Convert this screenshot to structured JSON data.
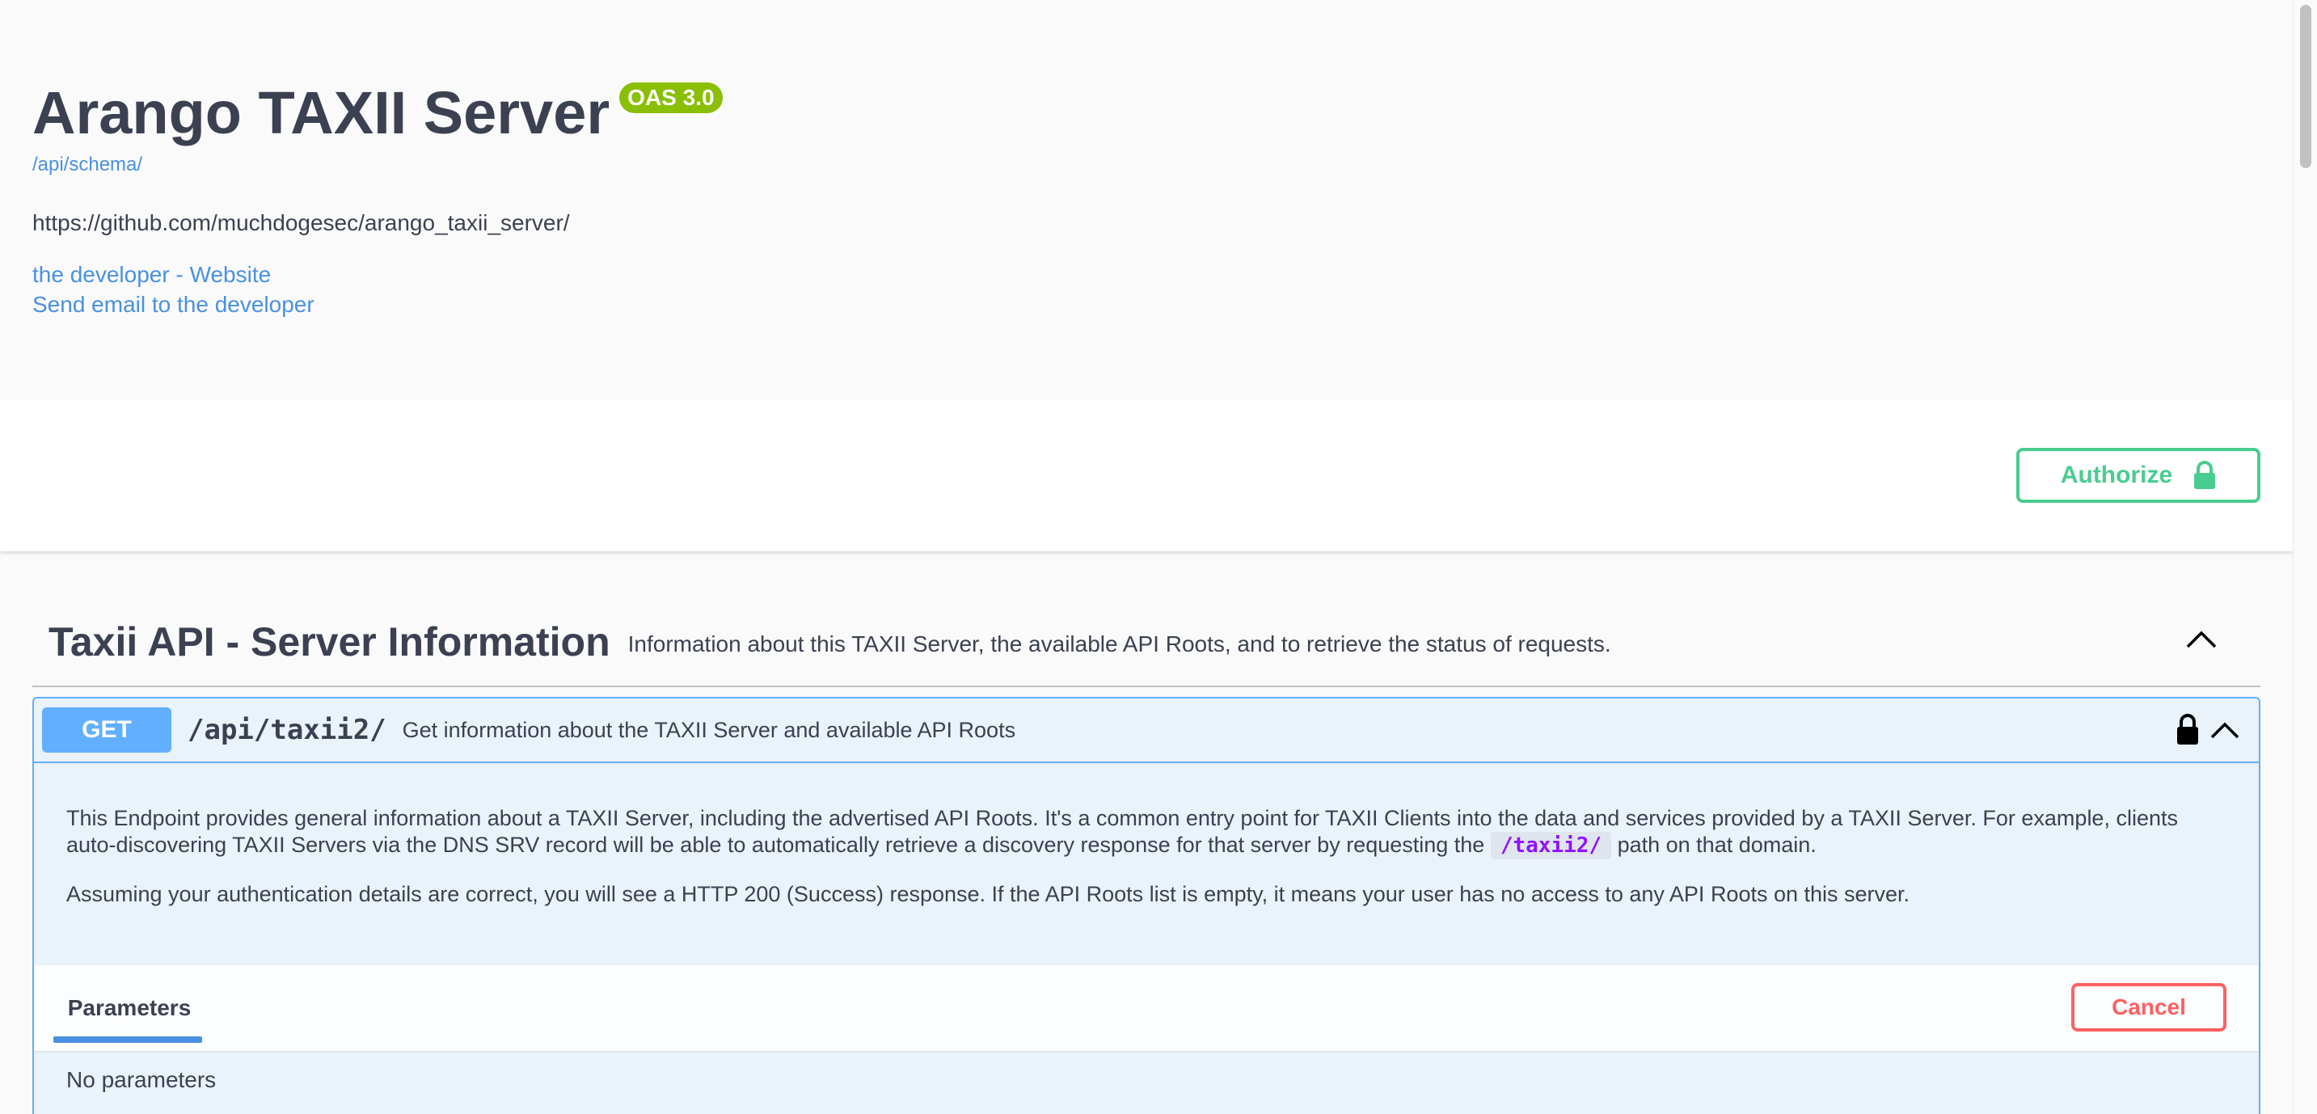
{
  "info": {
    "title": "Arango TAXII Server",
    "version_badge": "OAS 3.0",
    "schema_link": "/api/schema/",
    "description_url": "https://github.com/muchdogesec/arango_taxii_server/",
    "developer_website": "the developer - Website",
    "developer_email": "Send email to the developer"
  },
  "auth": {
    "authorize_label": "Authorize"
  },
  "tag": {
    "name": "Taxii API - Server Information",
    "description": "Information about this TAXII Server, the available API Roots, and to retrieve the status of requests."
  },
  "operation": {
    "method": "GET",
    "path": "/api/taxii2/",
    "summary": "Get information about the TAXII Server and available API Roots",
    "description_1_before": "This Endpoint provides general information about a TAXII Server, including the advertised API Roots. It's a common entry point for TAXII Clients into the data and services provided by a TAXII Server. For example, clients auto-discovering TAXII Servers via the DNS SRV record will be able to automatically retrieve a discovery response for that server by requesting the",
    "description_1_code": "/taxii2/",
    "description_1_after": "path on that domain.",
    "description_2": "Assuming your authentication details are correct, you will see a HTTP 200 (Success) response. If the API Roots list is empty, it means your user has no access to any API Roots on this server.",
    "parameters_tab": "Parameters",
    "cancel_label": "Cancel",
    "no_parameters": "No parameters"
  },
  "colors": {
    "get": "#61affe",
    "authorize": "#49cc90",
    "cancel": "#ff6060",
    "badge": "#89bf04",
    "link": "#4990e2"
  },
  "icons": [
    "lock-icon",
    "chevron-up-icon"
  ]
}
